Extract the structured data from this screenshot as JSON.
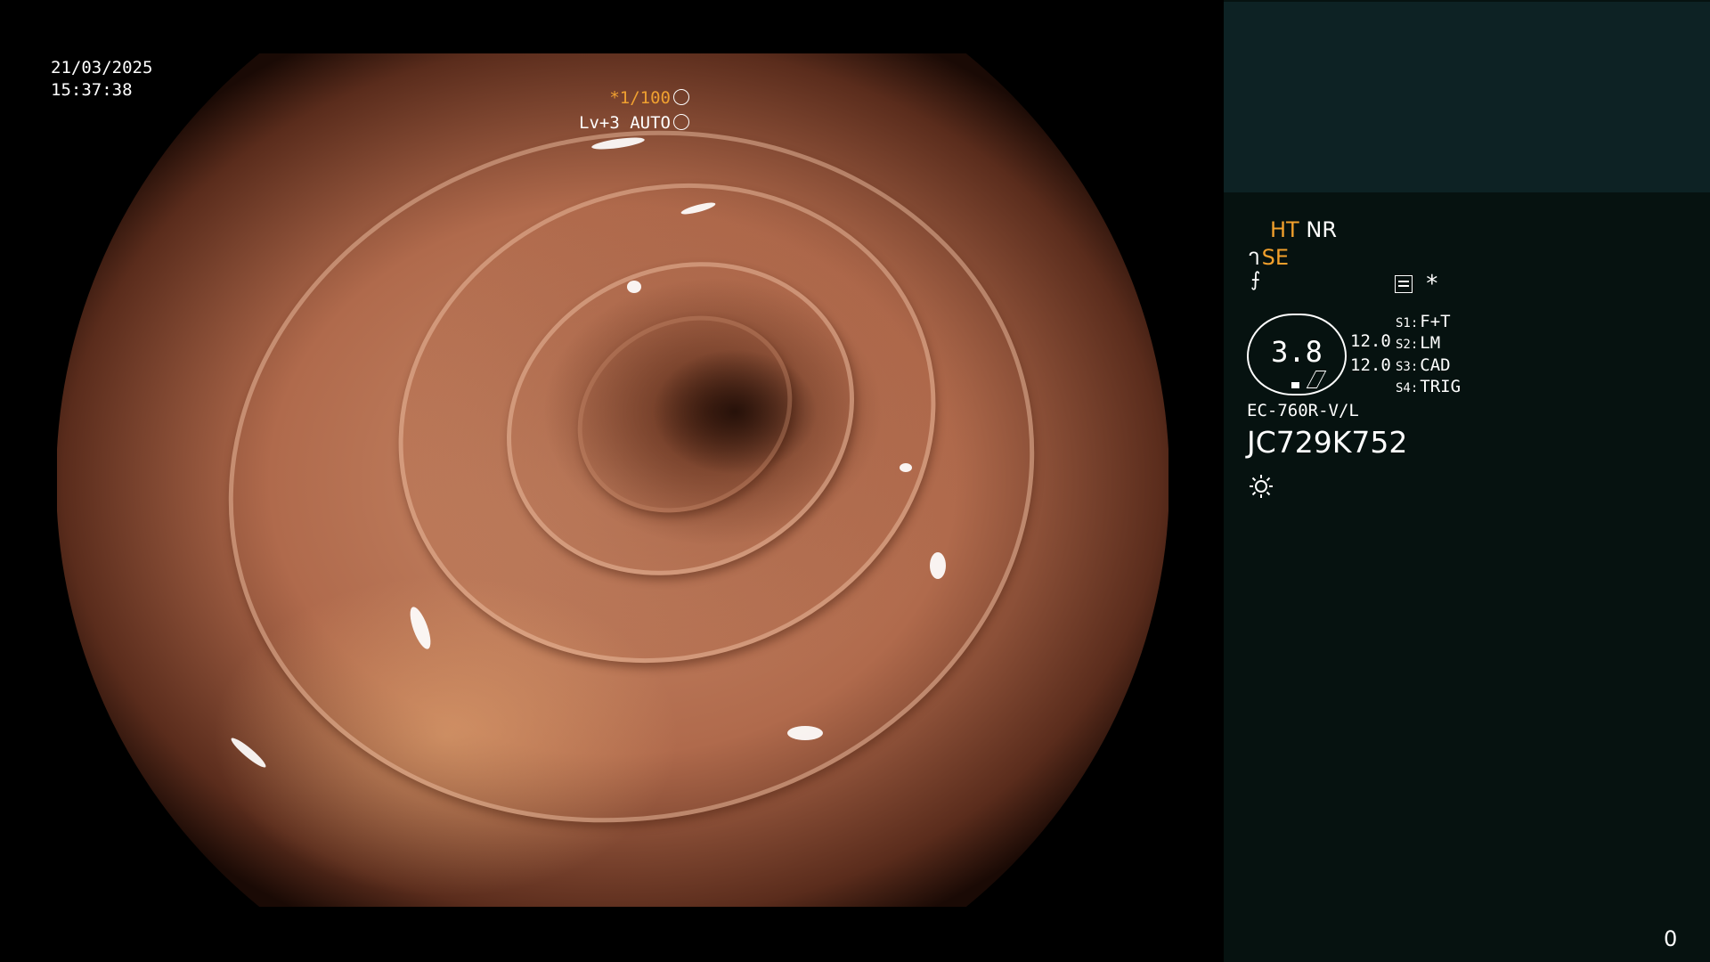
{
  "overlay": {
    "date": "21/03/2025",
    "time": "15:37:38",
    "shutter_prefix": "*1/100",
    "level": "Lv+3 AUTO"
  },
  "panel": {
    "ht": "HT",
    "nr": "NR",
    "se": "SE",
    "filter_symbol": "⨍",
    "asterisk": "*",
    "dial_value": "3.8",
    "value_1": "12.0",
    "value_2": "12.0",
    "switches": [
      {
        "key": "S1:",
        "label": "F+T"
      },
      {
        "key": "S2:",
        "label": "LM"
      },
      {
        "key": "S3:",
        "label": "CAD"
      },
      {
        "key": "S4:",
        "label": "TRIG"
      }
    ],
    "scope_model": "EC-760R-V/L",
    "serial": "JC729K752",
    "counter": "0"
  },
  "colors": {
    "orange": "#f2a02c",
    "panel_bg": "#061210",
    "thumb_bg": "#0d2224"
  },
  "icons": [
    "shutter-icon",
    "iris-icon",
    "menu-icon",
    "light-icon",
    "scope-tip-icon"
  ]
}
